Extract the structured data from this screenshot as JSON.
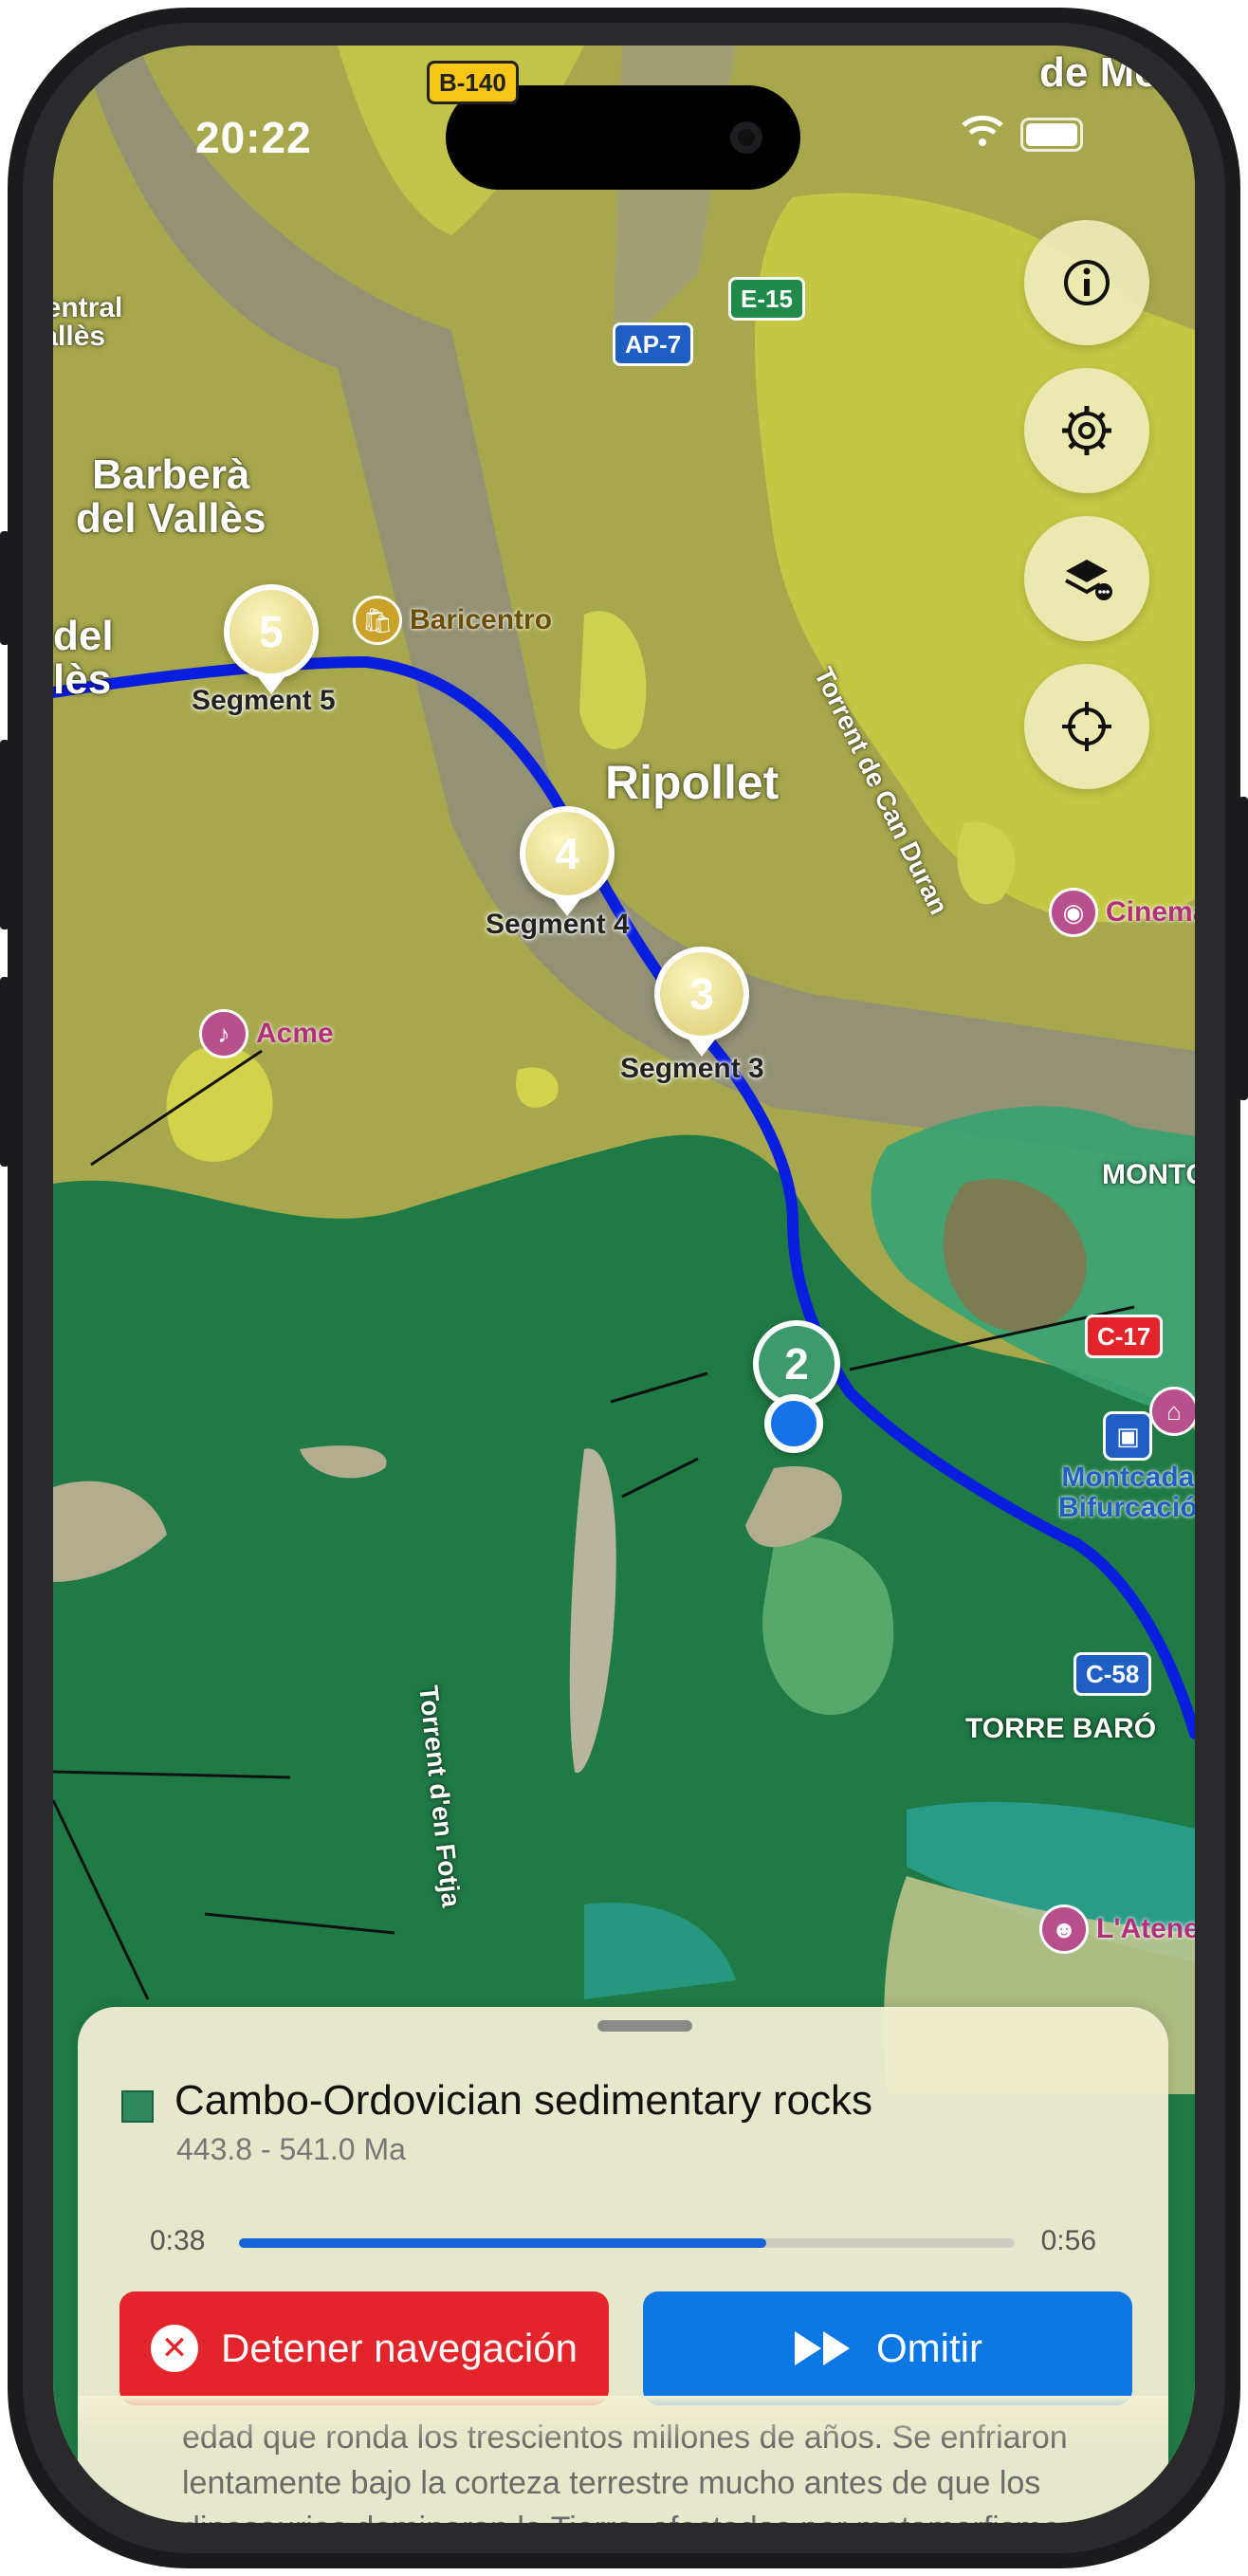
{
  "status_bar": {
    "time": "20:22"
  },
  "map": {
    "place_labels": [
      {
        "id": "barbera",
        "text": "Barberà\ndel Vallès"
      },
      {
        "id": "ripollet",
        "text": "Ripollet"
      },
      {
        "id": "torre-baro",
        "text": "TORRE BARÓ"
      },
      {
        "id": "montc",
        "text": "MONTC"
      },
      {
        "id": "central",
        "text": "Central\nVallès"
      },
      {
        "id": "del-les",
        "text": "del\nlès"
      },
      {
        "id": "demo",
        "text": "de Mo"
      }
    ],
    "road_labels": [
      {
        "id": "can-duran",
        "text": "Torrent de Can Duran"
      },
      {
        "id": "fotja",
        "text": "Torrent d'en Fotja"
      }
    ],
    "road_shields": [
      {
        "id": "b140",
        "text": "B-140",
        "color": "#f5c518",
        "text_color": "#222"
      },
      {
        "id": "ap7",
        "text": "AP-7",
        "color": "#1f5fc4",
        "text_color": "#fff"
      },
      {
        "id": "e15",
        "text": "E-15",
        "color": "#1f8a4a",
        "text_color": "#fff"
      },
      {
        "id": "c17",
        "text": "C-17",
        "color": "#e3242b",
        "text_color": "#fff"
      },
      {
        "id": "c58",
        "text": "C-58",
        "color": "#1f5fc4",
        "text_color": "#fff"
      }
    ],
    "pois": [
      {
        "id": "baricentro",
        "text": "Baricentro",
        "color": "#c9a227",
        "text_color": "#6a4f00",
        "icon": "shopping-bag-icon"
      },
      {
        "id": "acme",
        "text": "Acme",
        "color": "#b8508e",
        "text_color": "#b0307a",
        "icon": "music-note-icon"
      },
      {
        "id": "cinema",
        "text": "Cinema",
        "color": "#b8508e",
        "text_color": "#b0307a",
        "icon": "film-camera-icon"
      },
      {
        "id": "montcada",
        "text": "Montcada\nBifurcació",
        "color": "#1f5fc4",
        "text_color": "#1f5fc4",
        "icon": "train-icon"
      },
      {
        "id": "ateneu",
        "text": "L'Atene",
        "color": "#b8508e",
        "text_color": "#b0307a",
        "icon": "theater-mask-icon"
      },
      {
        "id": "museum",
        "text": "",
        "color": "#b8508e",
        "text_color": "#b0307a",
        "icon": "museum-icon"
      }
    ],
    "segments": [
      {
        "number": "5",
        "label": "Segment 5"
      },
      {
        "number": "4",
        "label": "Segment 4"
      },
      {
        "number": "3",
        "label": "Segment 3"
      }
    ],
    "current_segment": "2",
    "route_color": "#0a1ee0"
  },
  "controls": {
    "icons": [
      "info-icon",
      "settings-gear-icon",
      "layers-icon",
      "crosshair-locate-icon"
    ]
  },
  "sheet": {
    "title": "Cambo-Ordovician sedimentary rocks",
    "age": "443.8 - 541.0 Ma",
    "swatch_color": "#2f8a5e",
    "elapsed": "0:38",
    "total": "0:56",
    "progress": 0.68,
    "stop_label": "Detener navegación",
    "skip_label": "Omitir",
    "description": "edad que ronda los trescientos millones de años. Se enfriaron lentamente bajo la corteza terrestre mucho antes de que los dinosaurios dominaran la Tierra, afectadas por metamorfismo..."
  }
}
